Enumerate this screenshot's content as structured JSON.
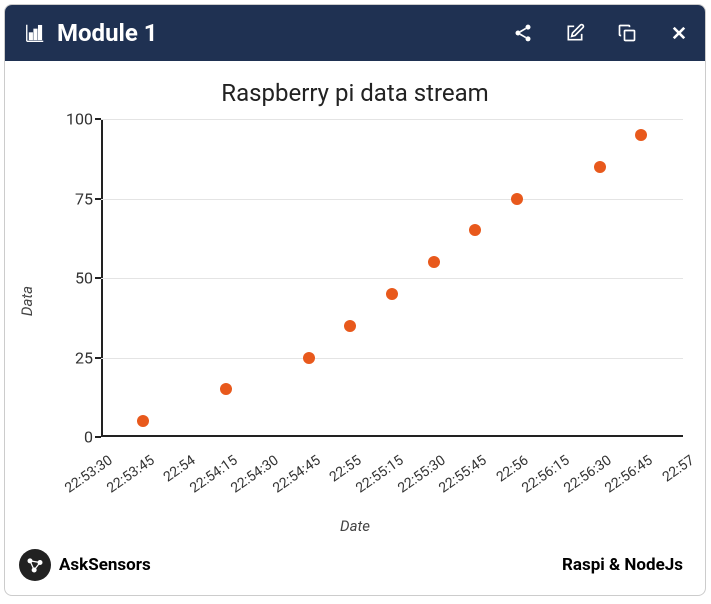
{
  "header": {
    "title": "Module 1"
  },
  "footer": {
    "brand": "AskSensors",
    "subtitle": "Raspi & NodeJs"
  },
  "chart_data": {
    "type": "scatter",
    "title": "Raspberry pi data stream",
    "xlabel": "Date",
    "ylabel": "Data",
    "ylim": [
      0,
      100
    ],
    "yticks": [
      0,
      25,
      50,
      75,
      100
    ],
    "xticks": [
      "22:53:30",
      "22:53:45",
      "22:54",
      "22:54:15",
      "22:54:30",
      "22:54:45",
      "22:55",
      "22:55:15",
      "22:55:30",
      "22:55:45",
      "22:56",
      "22:56:15",
      "22:56:30",
      "22:56:45",
      "22:57"
    ],
    "points": [
      {
        "xi": 1,
        "y": 5
      },
      {
        "xi": 3,
        "y": 15
      },
      {
        "xi": 5,
        "y": 25
      },
      {
        "xi": 6,
        "y": 35
      },
      {
        "xi": 7,
        "y": 45
      },
      {
        "xi": 8,
        "y": 55
      },
      {
        "xi": 9,
        "y": 65
      },
      {
        "xi": 10,
        "y": 75
      },
      {
        "xi": 12,
        "y": 85
      },
      {
        "xi": 13,
        "y": 95
      }
    ]
  }
}
